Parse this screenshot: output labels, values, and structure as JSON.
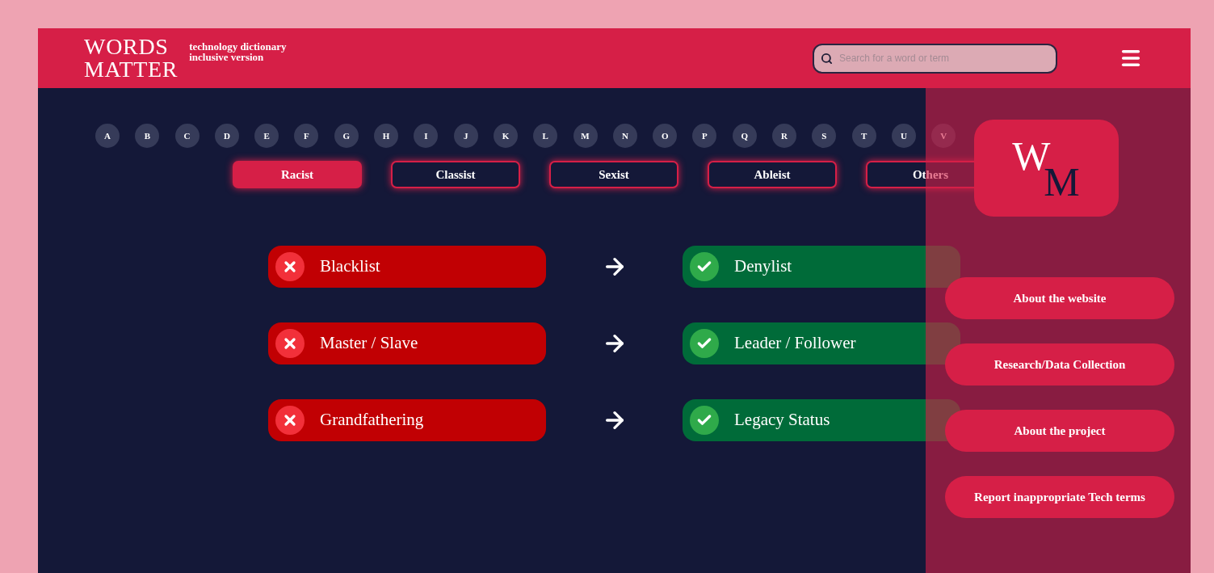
{
  "header": {
    "logo": [
      "WORDS",
      "MATTER"
    ],
    "tagline": [
      "technology dictionary",
      "inclusive version"
    ],
    "search": {
      "placeholder": "Search for a word or term"
    }
  },
  "letters": [
    "A",
    "B",
    "C",
    "D",
    "E",
    "F",
    "G",
    "H",
    "I",
    "J",
    "K",
    "L",
    "M",
    "N",
    "O",
    "P",
    "Q",
    "R",
    "S",
    "T",
    "U",
    "V"
  ],
  "filters": [
    {
      "label": "Racist",
      "selected": true
    },
    {
      "label": "Classist",
      "selected": false
    },
    {
      "label": "Sexist",
      "selected": false
    },
    {
      "label": "Ableist",
      "selected": false
    },
    {
      "label": "Others",
      "selected": false
    }
  ],
  "terms": [
    {
      "avoid": "Blacklist",
      "use": "Denylist"
    },
    {
      "avoid": "Master / Slave",
      "use": "Leader / Follower"
    },
    {
      "avoid": "Grandfathering",
      "use": "Legacy Status"
    }
  ],
  "side_menu": {
    "logo": [
      "W",
      "M"
    ],
    "items": [
      "About the website",
      "Research/Data Collection",
      "About the project",
      "Report inappropriate Tech terms"
    ]
  }
}
